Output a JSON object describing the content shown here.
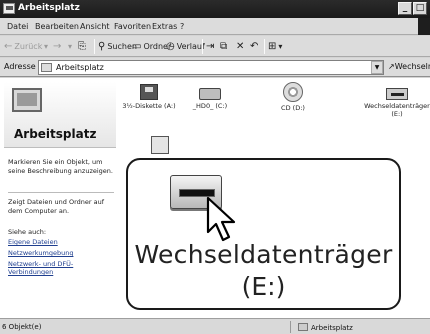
{
  "window": {
    "title": "Arbeitsplatz"
  },
  "menu": [
    "Datei",
    "Bearbeiten",
    "Ansicht",
    "Favoriten",
    "Extras",
    "?"
  ],
  "toolbar": {
    "back": "Zurück",
    "search": "Suchen",
    "folders": "Ordner",
    "history": "Verlauf"
  },
  "address": {
    "label": "Adresse",
    "value": "Arbeitsplatz",
    "go": "Wechseln"
  },
  "sidebar": {
    "title": "Arbeitsplatz",
    "description": "Markieren Sie ein Objekt, um seine Beschreibung anzuzeigen.",
    "info": "Zeigt Dateien und Ordner auf dem Computer an.",
    "see_also": "Siehe auch:",
    "links": [
      "Eigene Dateien",
      "Netzwerkumgebung",
      "Netzwerk- und DFÜ-Verbindungen"
    ]
  },
  "drives": [
    {
      "label": "3½-Diskette (A:)",
      "icon": "floppy-icon"
    },
    {
      "label": "_HD0_ (C:)",
      "icon": "hard-disk-icon"
    },
    {
      "label": "CD (D:)",
      "icon": "cd-drive-icon"
    },
    {
      "label": "Wechseldatenträger (E:)",
      "icon": "removable-drive-icon"
    }
  ],
  "zoom": {
    "name": "Wechseldatenträger",
    "letter": "(E:)"
  },
  "status": {
    "objects": "6 Objekt(e)",
    "location": "Arbeitsplatz"
  }
}
